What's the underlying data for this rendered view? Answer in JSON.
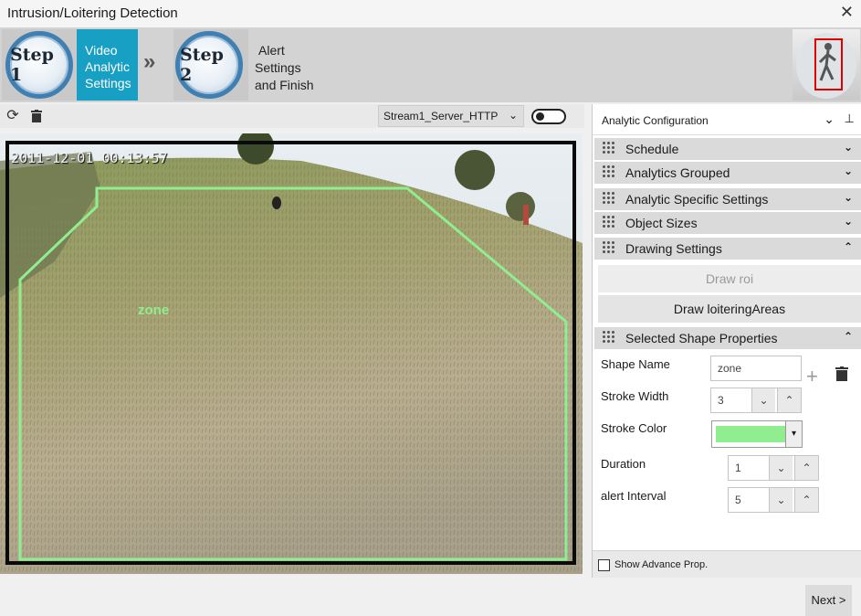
{
  "window": {
    "title": "Intrusion/Loitering Detection",
    "close_glyph": "✕"
  },
  "wizard": {
    "step1": {
      "badge": "Step 1",
      "label_lines": [
        "Video",
        "Analytic",
        "Settings"
      ]
    },
    "step2": {
      "badge": "Step 2",
      "label_lines": [
        "Alert",
        "Settings",
        "and Finish"
      ]
    },
    "separator": "»"
  },
  "video_toolbar": {
    "refresh_icon": "refresh-icon",
    "delete_icon": "trash-icon",
    "stream": "Stream1_Server_HTTP",
    "toggle_on": false
  },
  "video": {
    "timestamp": "2011-12-01  00:13:57",
    "zone_label": "zone",
    "zone_color": "#90ee90"
  },
  "panel": {
    "title": "Analytic Configuration",
    "sections": [
      {
        "label": "Schedule",
        "expanded": false
      },
      {
        "label": "Analytics Grouped",
        "expanded": false
      },
      {
        "label": "Analytic Specific Settings",
        "expanded": false
      },
      {
        "label": "Object Sizes",
        "expanded": false
      },
      {
        "label": "Drawing Settings",
        "expanded": true
      },
      {
        "label": "Selected Shape Properties",
        "expanded": true
      }
    ],
    "drawing": {
      "draw_roi": "Draw roi",
      "draw_loitering": "Draw loiteringAreas"
    },
    "properties": {
      "shape_name_label": "Shape Name",
      "shape_name_value": "zone",
      "stroke_width_label": "Stroke Width",
      "stroke_width_value": "3",
      "stroke_color_label": "Stroke Color",
      "stroke_color_value": "#90ee90",
      "duration_label": "Duration",
      "duration_value": "1",
      "alert_interval_label": "alert Interval",
      "alert_interval_value": "5"
    },
    "show_advance": "Show Advance Prop."
  },
  "footer": {
    "next": "Next >"
  }
}
